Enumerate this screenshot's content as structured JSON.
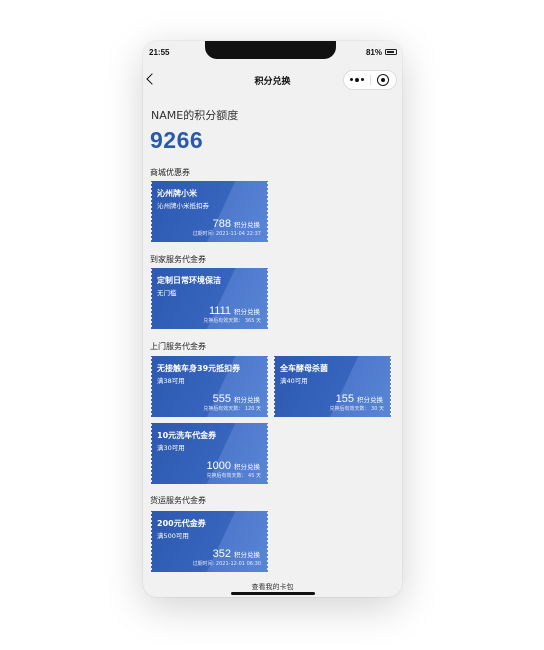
{
  "status": {
    "time": "21:55",
    "battery": "81%"
  },
  "nav": {
    "title": "积分兑换"
  },
  "points": {
    "label": "NAME的积分额度",
    "value": "9266"
  },
  "sections": [
    {
      "title": "商城优惠券",
      "coupons": [
        {
          "name": "沁州牌小米",
          "sub": "沁州牌小米抵扣券",
          "points": "788",
          "unit": "积分兑换",
          "foot": "过期时间: 2021-11-04 22:37"
        }
      ]
    },
    {
      "title": "到家服务代金券",
      "coupons": [
        {
          "name": "定制日常环境保洁",
          "sub": "无门槛",
          "points": "1111",
          "unit": "积分兑换",
          "foot": "兑换后有效天数： 365 天"
        }
      ]
    },
    {
      "title": "上门服务代金券",
      "coupons": [
        {
          "name": "无接触车身39元抵扣券",
          "sub": "满38可用",
          "points": "555",
          "unit": "积分兑换",
          "foot": "兑换后有效天数： 120 天"
        },
        {
          "name": "全车酵母杀菌",
          "sub": "满40可用",
          "points": "155",
          "unit": "积分兑换",
          "foot": "兑换后有效天数： 30 天"
        },
        {
          "name": "10元洗车代金券",
          "sub": "满30可用",
          "points": "1000",
          "unit": "积分兑换",
          "foot": "兑换后有效天数： 45 天"
        }
      ]
    },
    {
      "title": "货运服务代金券",
      "coupons": [
        {
          "name": "200元代金券",
          "sub": "满500可用",
          "points": "352",
          "unit": "积分兑换",
          "foot": "过期时间: 2021-12-01 06:30"
        }
      ]
    }
  ],
  "footer": {
    "link": "查看我的卡包"
  }
}
